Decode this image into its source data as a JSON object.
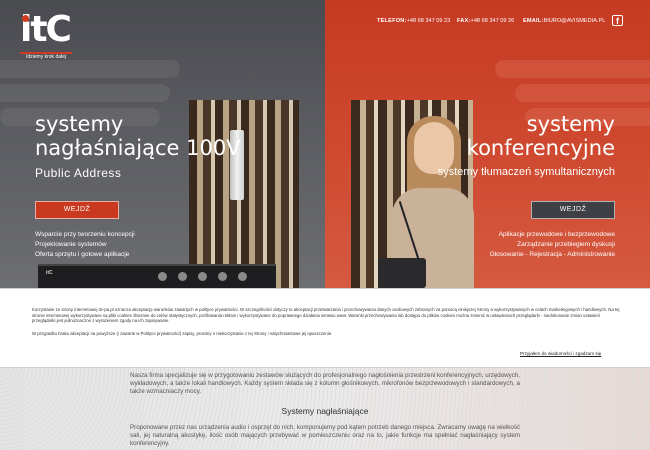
{
  "brand": {
    "logo_text": "itC",
    "tagline": "Idziemy krok dalej"
  },
  "header": {
    "phone_label": "TELEFON:",
    "phone": "+48 68 347 09 23",
    "fax_label": "FAX:",
    "fax": "+48 68 347 09 26",
    "email_label": "EMAIL:",
    "email": "BIURO@AVISMEDIA.PL",
    "facebook_icon": "facebook-icon"
  },
  "hero": {
    "left": {
      "title_line1": "systemy",
      "title_line2": "nagłaśniające 100V",
      "subtitle": "Public Address",
      "button": "WEJDŹ",
      "features": [
        "Wsparcie przy tworzeniu koncepcji",
        "Projektowanie systemów",
        "Oferta sprzętu i gotowe aplikacje"
      ],
      "product_label": "itC"
    },
    "right": {
      "title_line1": "systemy",
      "title_line2": "konferencyjne",
      "subtitle": "systemy tłumaczeń symultanicznych",
      "button": "WEJDŹ",
      "features": [
        "Aplikacje przewodowe i bezprzewodowe",
        "Zarządzanie przebiegiem dyskusji",
        "Głosowanie - Rejestracja - Administrowanie"
      ]
    },
    "colors": {
      "left_bg": "#55565b",
      "right_bg": "#cc4329",
      "accent": "#c8391f"
    }
  },
  "cookie": {
    "text": "Korzystanie ze strony internetowej itc-pa.pl oznacza akceptację warunków zawartych w polityce prywatności. W szczególności dotyczy to akceptacji przetwarzania i przechowywania danych osobowych zebranych za pomocą niniejszej Strony a wykorzystywanych w celach marketingowych i handlowych. Na tej stronie internetowej wykorzystywane są pliki cookies zbierane do celów statystycznych, profilowania reklam i wykorzystywane do poprawnego działania serwisu www. Warunki przechowywania lub dostępu do plików cookies można zmienić w ustawieniach przeglądarki - niedokonanie zmian ustawień przeglądarki jest jednoznaczne z wyrażeniem zgody na ich zapisywanie.",
    "text2": "W przypadku braku akceptacji na powyższe (i zawarte w Polityce prywatności) zapisy, prosimy o niekorzystanie z tej Strony i natychmiastowe jej opuszczenie.",
    "accept": "Przyjałem do wiadomości i zgadzam się"
  },
  "content": {
    "paragraph1": "Nasza firma specjalizuje się w przygotowaniu zestawów służących do profesjonalnego nagłośnienia przestrzeni konferencyjnych, urzędowych, wykładowych, a także lokali handlowych. Każdy system składa się z kolumn głośnikowych, mikrofonów bezprzewodowych i standardowych, a także wzmacniaczy mocy.",
    "section_title": "Systemy nagłaśniające",
    "paragraph2": "Proponowane przez nas urządzenia audio i osprzęt do nich, komponujemy pod kątem potrzeb danego miejsca. Zwracamy uwagę na wielkość sali, jej naturalną akustykę, ilość osób mających przebywać w pomieszczeniu oraz na to, jakie funkcje ma spełniać nagłaśniający system konferencyjny."
  }
}
